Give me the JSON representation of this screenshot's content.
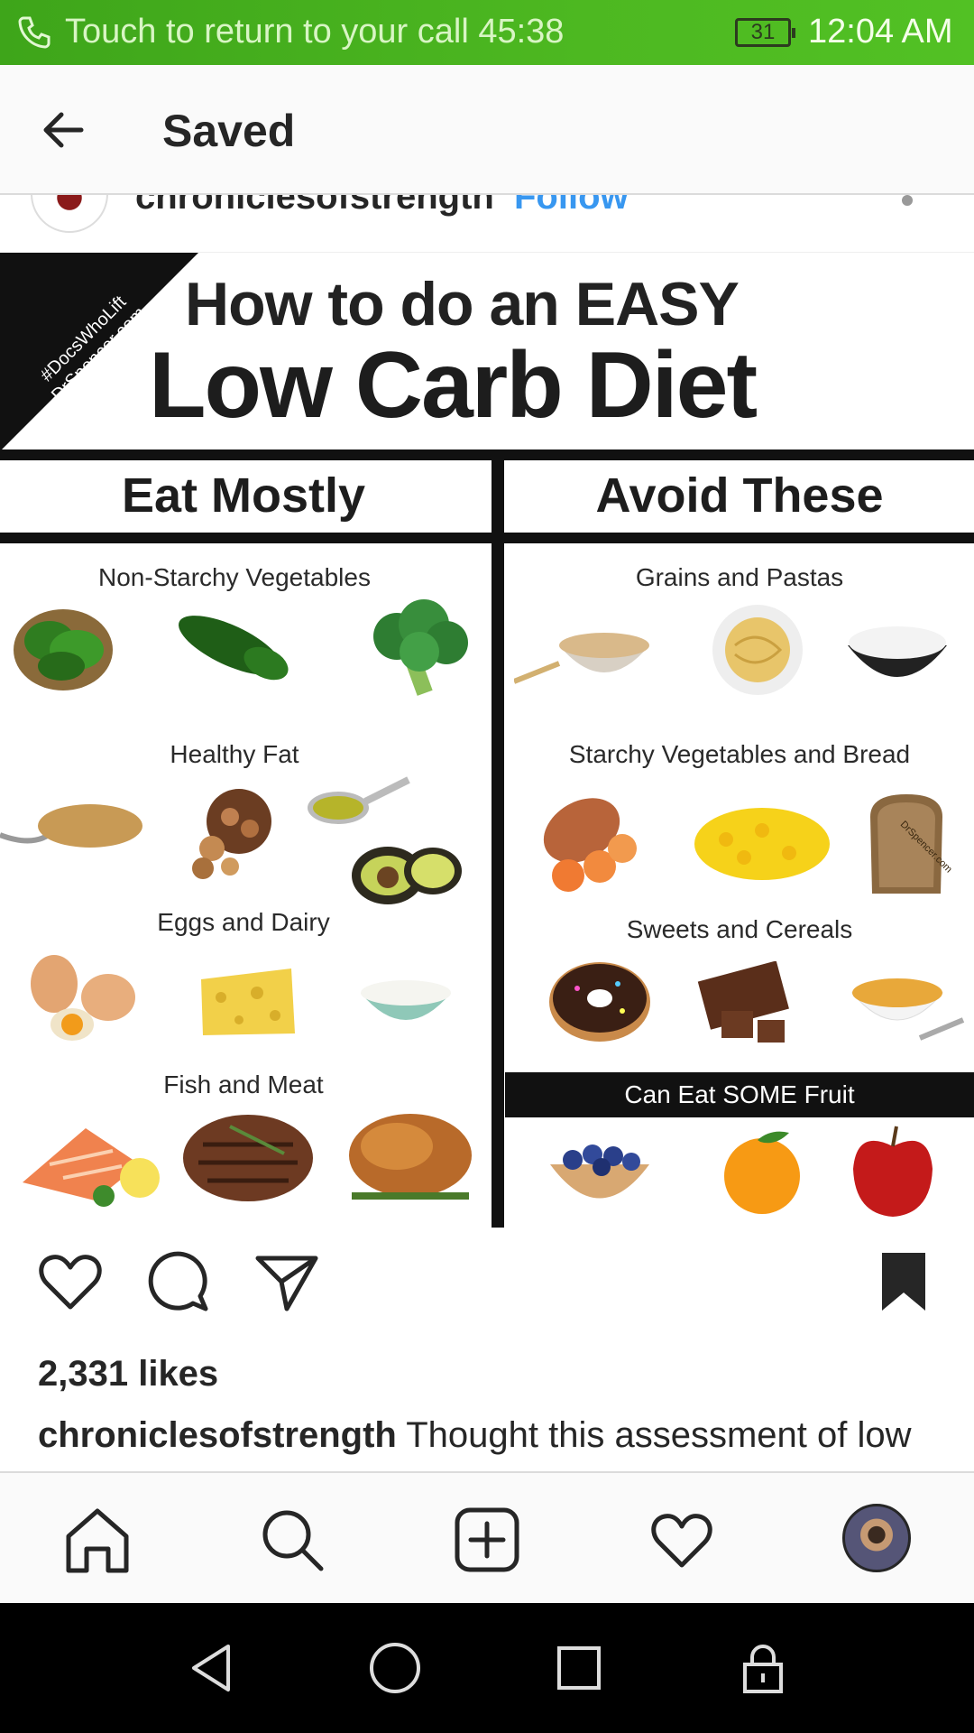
{
  "status_bar": {
    "call_text": "Touch to return to your call",
    "call_timer": "45:38",
    "battery": "31",
    "time": "12:04 AM"
  },
  "header": {
    "title": "Saved"
  },
  "post": {
    "username": "chroniclesofstrength",
    "follow_label": "Follow",
    "image": {
      "corner_text": [
        "#DocsWhoLift",
        "DrSpencer.com"
      ],
      "title_line1": "How to do an EASY",
      "title_line2": "Low Carb Diet",
      "left_heading": "Eat Mostly",
      "right_heading": "Avoid These",
      "left_groups": [
        "Non-Starchy Vegetables",
        "Healthy Fat",
        "Eggs and Dairy",
        "Fish and Meat"
      ],
      "right_groups": [
        "Grains and Pastas",
        "Starchy Vegetables and Bread",
        "Sweets and Cereals"
      ],
      "fruit_label": "Can Eat SOME Fruit",
      "bread_watermark": "DrSpencer.com"
    },
    "likes": "2,331 likes",
    "caption_user": "chroniclesofstrength",
    "caption_text": "Thought this assessment of low"
  },
  "icons": {
    "back": "arrow-left-icon",
    "like": "heart-outline-icon",
    "comment": "comment-icon",
    "share": "paper-plane-icon",
    "save": "bookmark-filled-icon",
    "home": "home-icon",
    "search": "search-icon",
    "add": "add-post-icon",
    "activity": "heart-icon",
    "profile": "profile-avatar"
  },
  "colors": {
    "status_bar": "#4db821",
    "link_blue": "#3897f0",
    "text": "#262626"
  }
}
